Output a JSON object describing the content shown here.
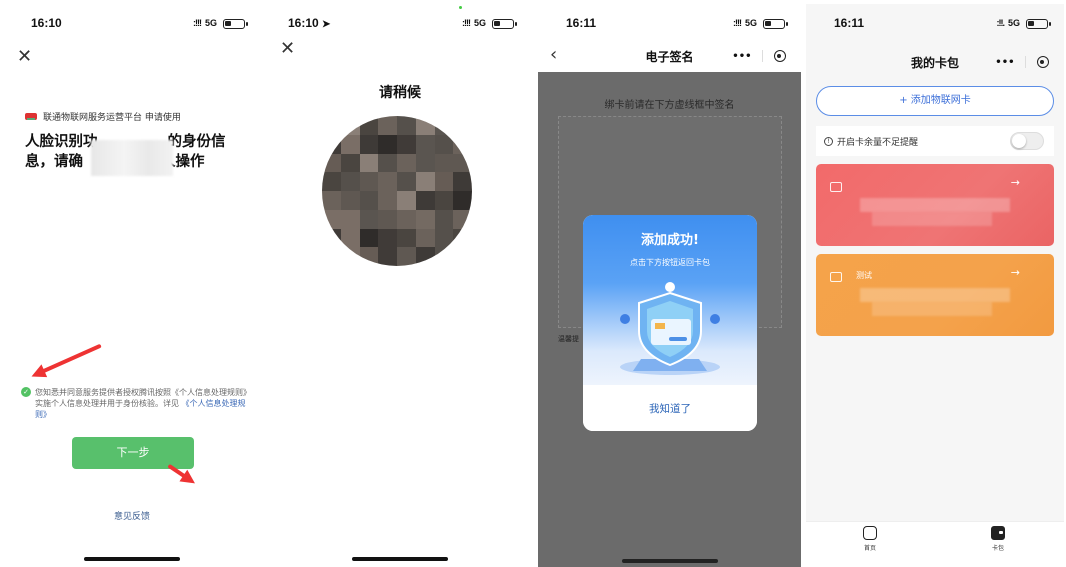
{
  "screens": {
    "s1": {
      "time": "16:10",
      "network": "5G",
      "brand": "联通物联网服务运营平台 申请使用",
      "title_line1": "人脸识别功",
      "title_line1_end": "的身份信",
      "title_line2": "息，请确",
      "title_line2_end": "人操作",
      "consent_text": "您知悉并同意服务提供者授权腾讯按照《个人信息处理规则》实施个人信息处理并用于身份核验。详见",
      "consent_link": "《个人信息处理规则》",
      "next_label": "下一步",
      "feedback_label": "意见反馈"
    },
    "s2": {
      "time": "16:10",
      "network": "5G",
      "title": "请稍候"
    },
    "s3": {
      "time": "16:11",
      "network": "5G",
      "title": "电子签名",
      "sign_hint": "绑卡前请在下方虚线框中签名",
      "strip_text": "温馨提",
      "modal_title": "添加成功!",
      "modal_sub": "点击下方按钮返回卡包",
      "modal_btn": "我知道了"
    },
    "s4": {
      "time": "16:11",
      "network": "5G",
      "title": "我的卡包",
      "add_label": "+ 添加物联网卡",
      "remind_label": "开启卡余量不足提醒",
      "card2_name": "测试",
      "tab_home": "首页",
      "tab_wallet": "卡包"
    }
  },
  "colors": {
    "green_button": "#58c06c",
    "modal_blue": "#3f8ff0",
    "card_red": "#f26a6a",
    "card_orange": "#f5a34a"
  }
}
